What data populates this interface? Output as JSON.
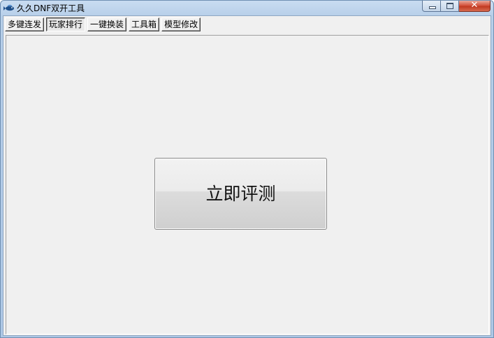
{
  "window": {
    "title": "久久DNF双开工具",
    "icon": "app-fish-icon",
    "controls": {
      "minimize_icon": "minimize-icon",
      "maximize_icon": "maximize-icon",
      "close_icon": "close-icon",
      "close_glyph": "✕"
    }
  },
  "tabs": [
    {
      "label": "多键连发",
      "active": false
    },
    {
      "label": "玩家排行",
      "active": true
    },
    {
      "label": "一键换装",
      "active": false
    },
    {
      "label": "工具箱",
      "active": false
    },
    {
      "label": "模型修改",
      "active": false
    }
  ],
  "panel": {
    "evaluate_button_label": "立即评测"
  },
  "colors": {
    "titlebar": "#c9dcf1",
    "client_bg": "#f0f0f0",
    "close_button": "#c13a22"
  }
}
